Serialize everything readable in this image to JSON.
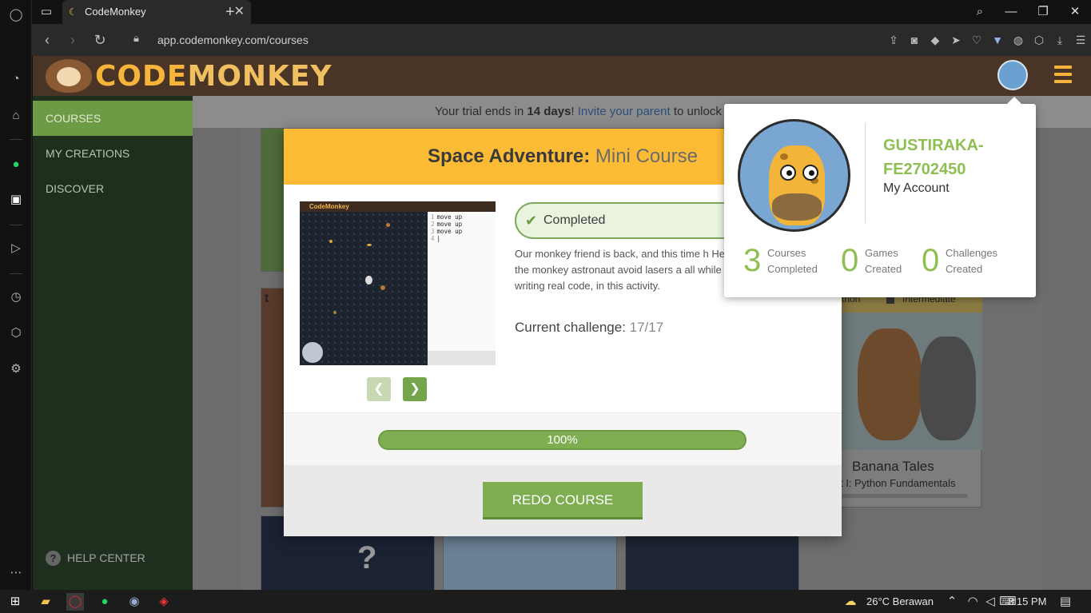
{
  "browser": {
    "tab_title": "CodeMonkey",
    "url": "app.codemonkey.com/courses",
    "new_tab": "+",
    "tab_close": "✕"
  },
  "site": {
    "logo_part1": "CODE",
    "logo_part2": "MONKEY",
    "nav": [
      {
        "label": "COURSES"
      },
      {
        "label": "MY CREATIONS"
      },
      {
        "label": "DISCOVER"
      }
    ],
    "help_label": "HELP CENTER",
    "trial": {
      "prefix": "Your trial ends in ",
      "days": "14 days",
      "bang": "! ",
      "link": "Invite your parent",
      "suffix": " to unlock p"
    },
    "background_card": {
      "title": "Banana Tales",
      "subtitle": "t I: Python Fundamentals",
      "tag_left": "thon",
      "tag_right": "Intermediate"
    }
  },
  "modal": {
    "title_bold": "Space Adventure:",
    "title_light": " Mini Course",
    "preview_brand": "CodeMonkey",
    "preview_code": [
      "move up",
      "move up",
      "move up"
    ],
    "status": "Completed",
    "description": "Our monkey friend is back, and this time h Help the monkey astronaut avoid lasers a all while writing real code, in this activity.",
    "challenge_label": "Current challenge:",
    "challenge_value": " 17/17",
    "progress_text": "100%",
    "progress_value": 1.0,
    "redo_label": "REDO COURSE"
  },
  "account": {
    "username": "GUSTIRAKA-FE2702450",
    "link": "My Account",
    "stats": [
      {
        "num": "3",
        "line1": "Courses",
        "line2": "Completed"
      },
      {
        "num": "0",
        "line1": "Games",
        "line2": "Created"
      },
      {
        "num": "0",
        "line1": "Challenges",
        "line2": "Created"
      }
    ]
  },
  "taskbar": {
    "weather": "26°C  Berawan",
    "time": "8:15 PM"
  },
  "colors": {
    "accent_green": "#7fae52",
    "header_yellow": "#fbbb35",
    "site_header": "#4a3426"
  }
}
